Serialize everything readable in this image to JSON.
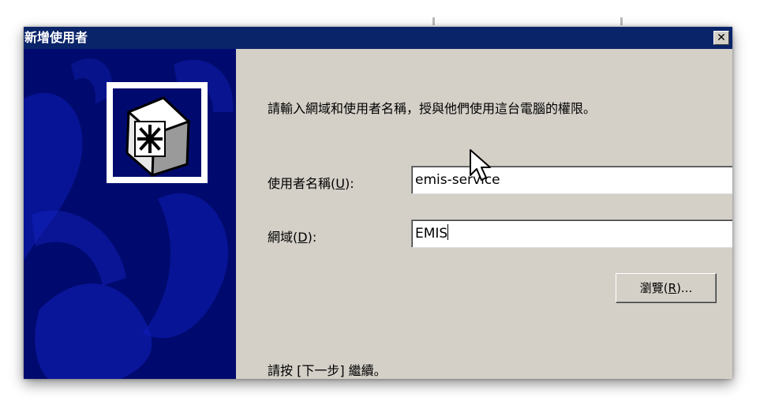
{
  "window": {
    "title": "新增使用者",
    "close_label": "✕"
  },
  "content": {
    "intro": "請輸入網域和使用者名稱，授與他們使用這台電腦的權限。",
    "username_label_prefix": "使用者名稱(",
    "username_label_key": "U",
    "username_label_suffix": "):",
    "username_value": "emis-service",
    "domain_label_prefix": "網域(",
    "domain_label_key": "D",
    "domain_label_suffix": "):",
    "domain_value": "EMIS",
    "browse_prefix": "瀏覽(",
    "browse_key": "R",
    "browse_suffix": ")...",
    "footer": "請按 [下一步] 繼續。"
  },
  "colors": {
    "titlebar": "#0a246a",
    "side_panel": "#000a6e",
    "dialog_bg": "#d4d0c8"
  },
  "icons": {
    "side": "snowflake-card-icon",
    "cursor": "mouse-pointer-icon"
  }
}
